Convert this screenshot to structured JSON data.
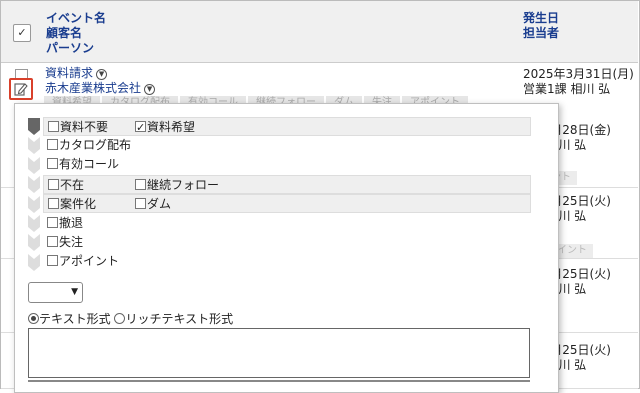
{
  "header": {
    "select_all_mark": "✓",
    "col1": "イベント名",
    "col2": "顧客名",
    "col3": "パーソン",
    "col4": "発生日",
    "col5": "担当者"
  },
  "rows": [
    {
      "event": "資料請求",
      "customer": "赤木産業株式会社",
      "date": "2025年3月31日(月)",
      "owner": "営業1課 相川 弘"
    },
    {
      "date": "5年3月28日(金)",
      "owner": "1課 相川 弘",
      "tag": "ント"
    },
    {
      "date": "5年3月25日(火)",
      "owner": "1課 相川 弘",
      "tag": "ポイント"
    },
    {
      "date": "5年3月25日(火)",
      "owner": "1課 相川 弘"
    },
    {
      "date": "5年3月25日(火)",
      "owner": "1課 相川 弘"
    }
  ],
  "pill_strip": [
    "資料希望",
    "カタログ配布",
    "有効コール",
    "継続フォロー",
    "ダム",
    "失注",
    "アポイント"
  ],
  "status_popup": {
    "rows": [
      {
        "a": "資料不要",
        "a_checked": false,
        "b": "資料希望",
        "b_checked": true,
        "band": true
      },
      {
        "a": "カタログ配布",
        "a_checked": false,
        "band": false
      },
      {
        "a": "有効コール",
        "a_checked": false,
        "band": false
      },
      {
        "a": "不在",
        "a_checked": false,
        "b": "継続フォロー",
        "b_checked": false,
        "band": true
      },
      {
        "a": "案件化",
        "a_checked": false,
        "b": "ダム",
        "b_checked": false,
        "band": true
      },
      {
        "a": "撤退",
        "a_checked": false,
        "band": false
      },
      {
        "a": "失注",
        "a_checked": false,
        "band": false
      },
      {
        "a": "アポイント",
        "a_checked": false,
        "band": false
      }
    ],
    "select_value": "",
    "format_text": "テキスト形式",
    "format_rich": "リッチテキスト形式",
    "textarea_value": ""
  },
  "icons": {
    "edit": "edit-icon",
    "dropdown": "dropdown-circle-icon",
    "chevron": "chevron-step-icon"
  },
  "colors": {
    "link": "#1a3d8f",
    "edit_border": "#d9402b",
    "header_bg": "#f0f0f0"
  }
}
